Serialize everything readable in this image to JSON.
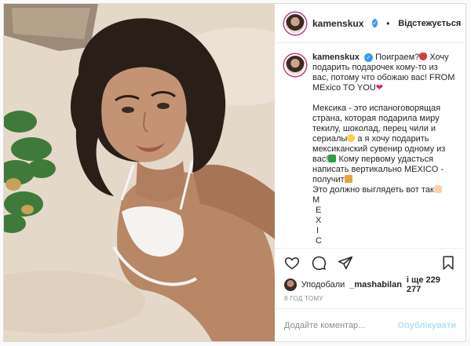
{
  "header": {
    "username": "kamenskux",
    "follow_label": "Відстежується",
    "separator": "•"
  },
  "caption": {
    "username": "kamenskux",
    "paragraph1": [
      "Поиграем?",
      " Хочу подарить подарочек кому-то из вас, потому что обожаю вас! FROM MExico TO YOU"
    ],
    "paragraph2": [
      "Мексика - это испаноговорящая страна, которая подарила миру текилу, шоколад, перец чили и сериалы",
      " а я хочу подарить мексиканский сувенир одному из вас!",
      " Кому первому удасться написать вертикально MEXICO - получит",
      "Это должно выглядеть вот так"
    ],
    "vertical_letters": [
      "M",
      "E",
      "X",
      "I",
      "C"
    ]
  },
  "likes": {
    "prefix": "Уподобали",
    "user": "_mashabilan",
    "suffix": "і ще 229 277"
  },
  "time": "8 год тому",
  "comment": {
    "placeholder": "Додайте коментар...",
    "post_label": "Опублікувати"
  },
  "icons": {
    "like": "heart-icon",
    "comment": "comment-icon",
    "share": "share-icon",
    "save": "bookmark-icon"
  }
}
